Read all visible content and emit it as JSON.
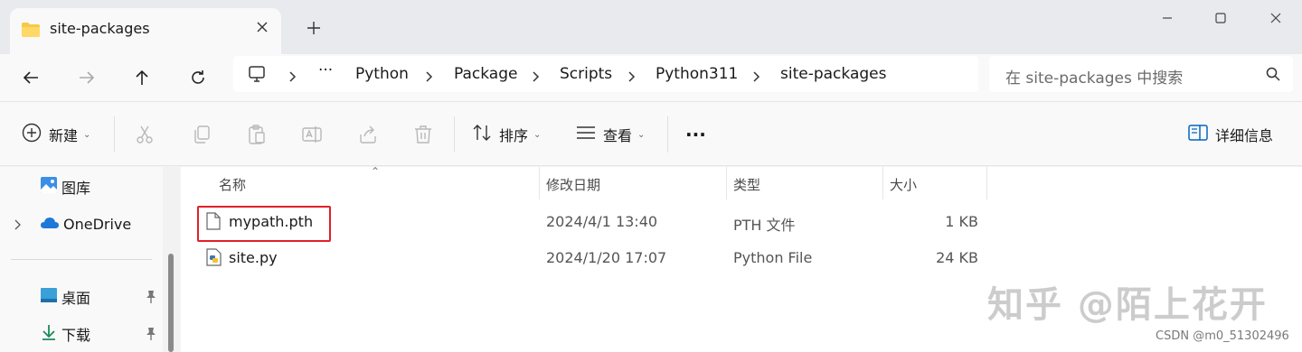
{
  "tab": {
    "title": "site-packages",
    "folder_icon": "folder-icon",
    "close_icon": "close-icon",
    "new_tab_icon": "plus-icon"
  },
  "window_controls": [
    "minimize-icon",
    "maximize-icon",
    "close-icon"
  ],
  "navigation": {
    "back_icon": "arrow-left-icon",
    "forward_icon": "arrow-right-icon",
    "up_icon": "arrow-up-icon",
    "refresh_icon": "refresh-icon"
  },
  "address": {
    "overflow": "···",
    "crumbs": [
      "Python",
      "Package",
      "Scripts",
      "Python311",
      "site-packages"
    ]
  },
  "search": {
    "placeholder": "在 site-packages 中搜索"
  },
  "commands": {
    "new_label": "新建",
    "sort_label": "排序",
    "view_label": "查看",
    "more": "···",
    "details_label": "详细信息"
  },
  "nav_pane": {
    "items": [
      {
        "label": "图库"
      },
      {
        "label": "OneDrive"
      },
      {
        "label": "桌面"
      },
      {
        "label": "下载"
      }
    ]
  },
  "file_list": {
    "columns": [
      "名称",
      "修改日期",
      "类型",
      "大小"
    ],
    "rows": [
      {
        "name": "mypath.pth",
        "modified": "2024/4/1 13:40",
        "type": "PTH 文件",
        "size": "1 KB"
      },
      {
        "name": "site.py",
        "modified": "2024/1/20 17:07",
        "type": "Python File",
        "size": "24 KB"
      }
    ]
  },
  "watermark": "知乎 @陌上花开",
  "credit": "CSDN @m0_51302496",
  "colors": {
    "highlight": "#e0202a",
    "accent": "#0067c0"
  }
}
